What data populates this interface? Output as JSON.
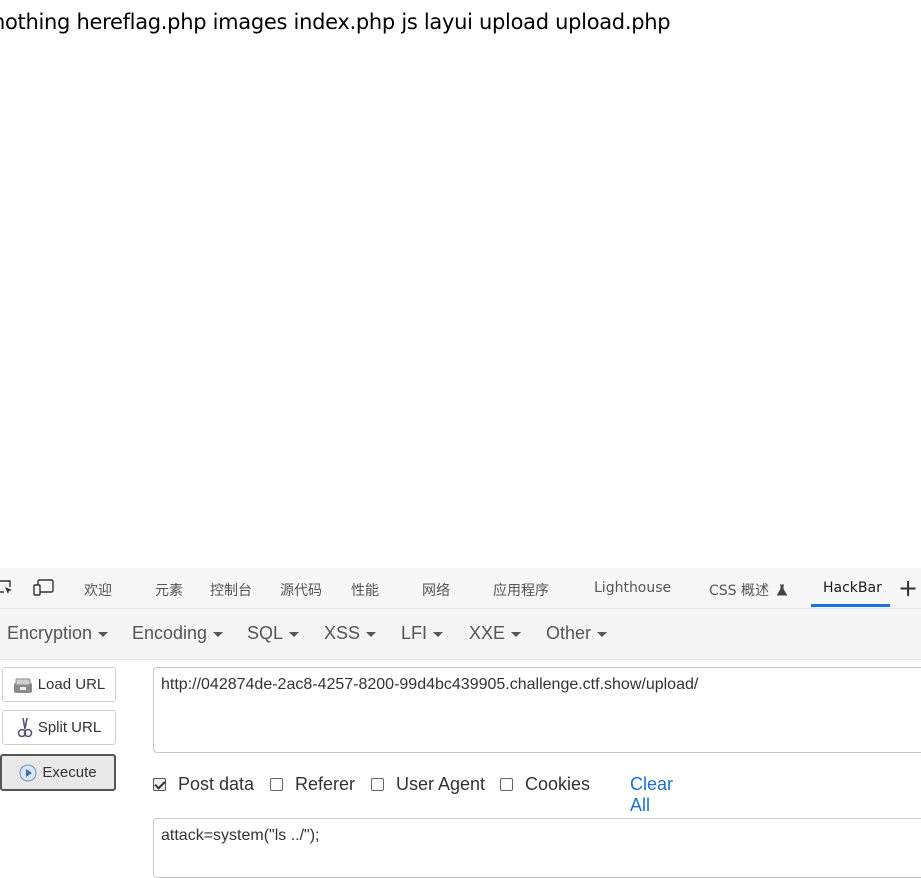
{
  "page": {
    "text": "nothing hereflag.php images index.php js layui upload upload.php"
  },
  "devtools": {
    "tabs": [
      "欢迎",
      "元素",
      "控制台",
      "源代码",
      "性能",
      "网络",
      "应用程序",
      "Lighthouse",
      "CSS 概述",
      "HackBar"
    ],
    "active_tab": "HackBar",
    "accent_color": "#1a73e8",
    "icons": [
      "inspect-icon",
      "device-toolbar-icon",
      "flask-icon",
      "plus-icon"
    ]
  },
  "hackbar": {
    "menus": [
      "Encryption",
      "Encoding",
      "SQL",
      "XSS",
      "LFI",
      "XXE",
      "Other"
    ],
    "buttons": {
      "load_url": "Load URL",
      "split_url": "Split URL",
      "execute": "Execute"
    },
    "url_value": "http://042874de-2ac8-4257-8200-99d4bc439905.challenge.ctf.show/upload/",
    "options": {
      "post_data": {
        "label": "Post data",
        "checked": true
      },
      "referer": {
        "label": "Referer",
        "checked": false
      },
      "user_agent": {
        "label": "User Agent",
        "checked": false
      },
      "cookies": {
        "label": "Cookies",
        "checked": false
      }
    },
    "clear_all": "Clear All",
    "post_value": "attack=system(\"ls ../\");"
  }
}
